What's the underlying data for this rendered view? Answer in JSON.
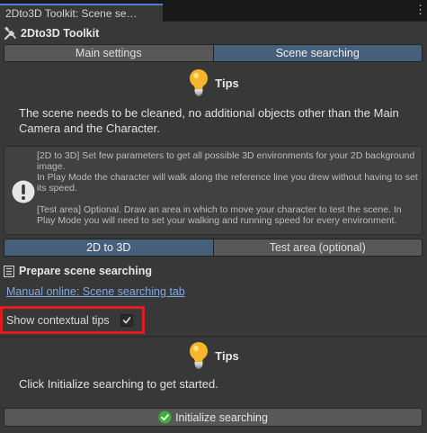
{
  "window": {
    "tab_title": "2Dto3D Toolkit: Scene se…",
    "menu_icon": "kebab-menu-icon"
  },
  "header": {
    "icon": "tools-icon",
    "title": "2Dto3D Toolkit"
  },
  "main_tabs": [
    {
      "label": "Main settings",
      "active": false
    },
    {
      "label": "Scene searching",
      "active": true
    }
  ],
  "tips_top": {
    "icon": "lightbulb-icon",
    "label": "Tips",
    "text": "The scene needs to be cleaned, no additional objects other than the Main Camera and the Character."
  },
  "help_box": {
    "icon": "exclamation-icon",
    "paragraphs": [
      "[2D to 3D] Set few parameters to get all possible 3D environments for your 2D background image.\nIn Play Mode the character will walk along the reference line you drew without having to set its speed.",
      "[Test area] Optional. Draw an area in which to move your character to test the scene. In Play Mode you will need to set your walking and running speed for every environment."
    ]
  },
  "sub_tabs": [
    {
      "label": "2D to 3D",
      "active": true
    },
    {
      "label": "Test area (optional)",
      "active": false
    }
  ],
  "section": {
    "icon": "document-icon",
    "title": "Prepare scene searching"
  },
  "manual_link": "Manual online: Scene searching tab",
  "contextual_tips": {
    "label": "Show contextual tips",
    "checked": true
  },
  "tips_bottom": {
    "icon": "lightbulb-icon",
    "label": "Tips",
    "text": "Click Initialize searching to get started."
  },
  "initialize_button": {
    "icon": "green-check-icon",
    "label": "Initialize searching"
  },
  "colors": {
    "background": "#383838",
    "active_tab": "#46607c",
    "link": "#7ea9e0",
    "highlight": "#e01e1e",
    "bulb": "#f5b62a",
    "success": "#3fae3a"
  }
}
